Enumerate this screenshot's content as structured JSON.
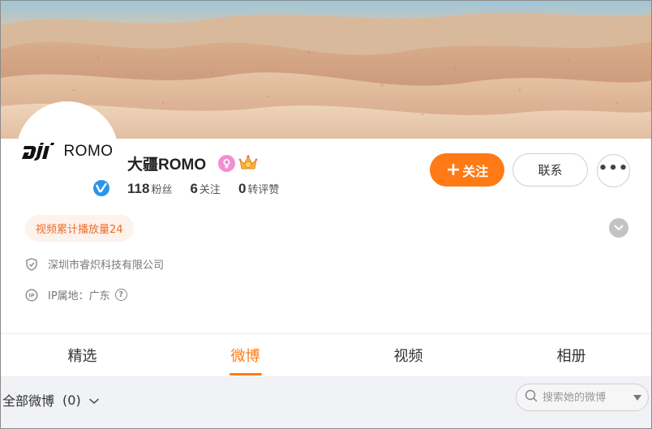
{
  "profile": {
    "avatar_text": "ROMO",
    "name": "大疆ROMO",
    "stats": [
      {
        "num": "118",
        "label": "粉丝"
      },
      {
        "num": "6",
        "label": "关注"
      },
      {
        "num": "0",
        "label": "转评赞"
      }
    ]
  },
  "actions": {
    "follow_label": "关注",
    "contact_label": "联系",
    "more_label": "•••"
  },
  "tag": "视频累计播放量24",
  "info": {
    "company": "深圳市睿炽科技有限公司",
    "ip_label": "IP属地：广东"
  },
  "tabs": [
    {
      "label": "精选",
      "active": false
    },
    {
      "label": "微博",
      "active": true
    },
    {
      "label": "视频",
      "active": false
    },
    {
      "label": "相册",
      "active": false
    }
  ],
  "filter": {
    "label": "全部微博",
    "count": "(0)"
  },
  "search": {
    "placeholder": "搜索她的微博"
  },
  "colors": {
    "accent": "#ff7a14",
    "verified": "#2a95ea",
    "tag_bg": "#fdf2ec",
    "tag_text": "#ef6d28"
  }
}
